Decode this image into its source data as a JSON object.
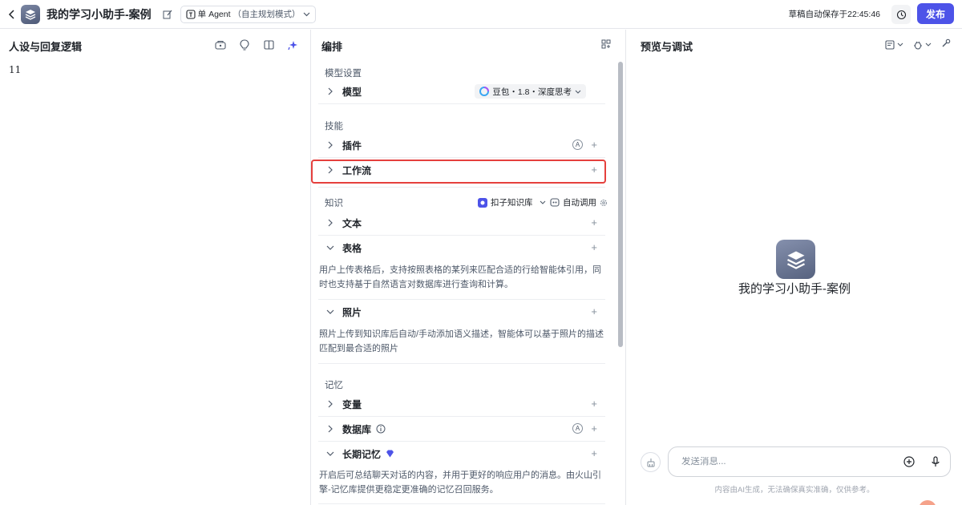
{
  "header": {
    "app_title": "我的学习小助手-案例",
    "mode_label": "单 Agent",
    "mode_sub": "（自主规划模式）",
    "saved_text": "草稿自动保存于22:45:46",
    "publish_label": "发布",
    "accent": "#4d53e8"
  },
  "left": {
    "title": "人设与回复逻辑",
    "prompt": "11"
  },
  "middle": {
    "title": "编排",
    "model_section": "模型设置",
    "model_row": "模型",
    "model_value": "豆包・1.8・深度思考",
    "skills_section": "技能",
    "plugin_row": "插件",
    "workflow_row": "工作流",
    "knowledge_section": "知识",
    "kb_source": "扣子知识库",
    "kb_mode": "自动调用",
    "text_row": "文本",
    "table_row": "表格",
    "table_desc": "用户上传表格后，支持按照表格的某列来匹配合适的行给智能体引用，同时也支持基于自然语言对数据库进行查询和计算。",
    "photo_row": "照片",
    "photo_desc": "照片上传到知识库后自动/手动添加语义描述，智能体可以基于照片的描述匹配到最合适的照片",
    "memory_section": "记忆",
    "variable_row": "变量",
    "database_row": "数据库",
    "longterm_row": "长期记忆",
    "longterm_desc": "开启后可总结聊天对话的内容，并用于更好的响应用户的消息。由火山引擎-记忆库提供更稳定更准确的记忆召回服务。",
    "auto_badge": "A",
    "plus": "+",
    "highlight_color": "#e5403d"
  },
  "right": {
    "title": "预览与调试",
    "bot_name": "我的学习小助手-案例",
    "input_placeholder": "发送消息...",
    "disclaimer": "内容由AI生成，无法确保真实准确，仅供参考。"
  }
}
